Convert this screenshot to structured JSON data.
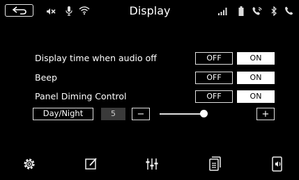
{
  "header": {
    "title": "Display",
    "icons": [
      "back-icon",
      "mute-icon",
      "microphone-icon",
      "wifi-icon",
      "signal-bars-icon",
      "battery-icon",
      "phone-link-icon",
      "bluetooth-icon",
      "call-icon"
    ]
  },
  "settings": {
    "rows": [
      {
        "label": "Display time when audio off",
        "off_label": "OFF",
        "on_label": "ON",
        "selected": "ON"
      },
      {
        "label": "Beep",
        "off_label": "OFF",
        "on_label": "ON",
        "selected": "ON"
      },
      {
        "label": "Panel Diming Control",
        "off_label": "OFF",
        "on_label": "ON",
        "selected": "ON"
      }
    ],
    "brightness": {
      "mode_label": "Day/Night",
      "value": "5",
      "minus_label": "−",
      "plus_label": "+",
      "level_fraction": 0.5
    }
  },
  "bottom_nav": {
    "icons": [
      "settings-gear-icon",
      "edit-icon",
      "equalizer-icon",
      "phone-list-icon",
      "phone-volume-icon"
    ]
  },
  "colors": {
    "background": "#000000",
    "foreground": "#ffffff",
    "selected_fill": "#ffffff",
    "value_box": "#3a3a3a"
  }
}
